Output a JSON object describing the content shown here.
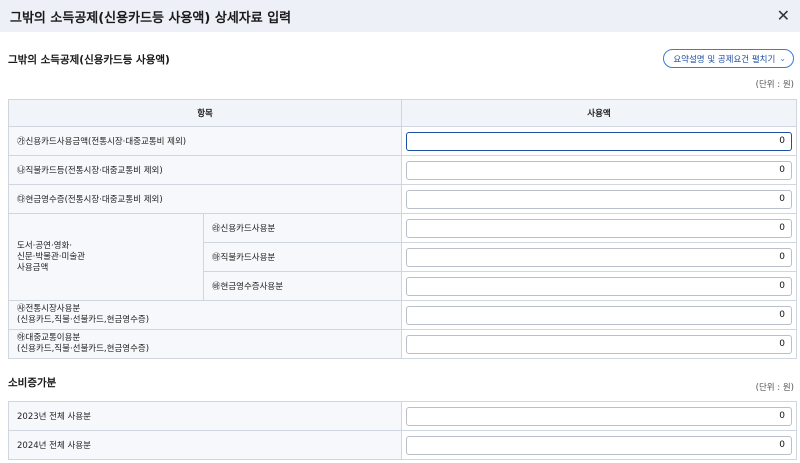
{
  "dialog": {
    "title": "그밖의 소득공제(신용카드등 사용액) 상세자료 입력",
    "close_label": "✕"
  },
  "section1": {
    "title": "그밖의 소득공제(신용카드등 사용액)",
    "expand_label": "요약설명 및 공제요건 펼치기",
    "unit": "(단위 : 원)",
    "header_item": "항목",
    "header_amount": "사용액",
    "rows": {
      "credit": {
        "label": "㉮신용카드사용금액(전통시장·대중교통비 제외)",
        "value": "0"
      },
      "debit": {
        "label": "㉯직불카드등(전통시장·대중교통비 제외)",
        "value": "0"
      },
      "cash": {
        "label": "㉰현금영수증(전통시장·대중교통비 제외)",
        "value": "0"
      },
      "culture_group": "도서·공연·영화·\n신문·박물관·미술관\n사용금액",
      "culture_credit": {
        "label": "㉱신용카드사용분",
        "value": "0"
      },
      "culture_debit": {
        "label": "㉲직불카드사용분",
        "value": "0"
      },
      "culture_cash": {
        "label": "㉳현금영수증사용분",
        "value": "0"
      },
      "market": {
        "label": "㉴전통시장사용분\n(신용카드,직불·선불카드,현금영수증)",
        "value": "0"
      },
      "transit": {
        "label": "㉵대중교통이용분\n(신용카드,직불·선불카드,현금영수증)",
        "value": "0"
      }
    }
  },
  "section2": {
    "title": "소비증가분",
    "unit": "(단위 : 원)",
    "rows": {
      "y2023": {
        "label": "2023년 전체 사용분",
        "value": "0"
      },
      "y2024": {
        "label": "2024년 전체 사용분",
        "value": "0"
      }
    }
  }
}
